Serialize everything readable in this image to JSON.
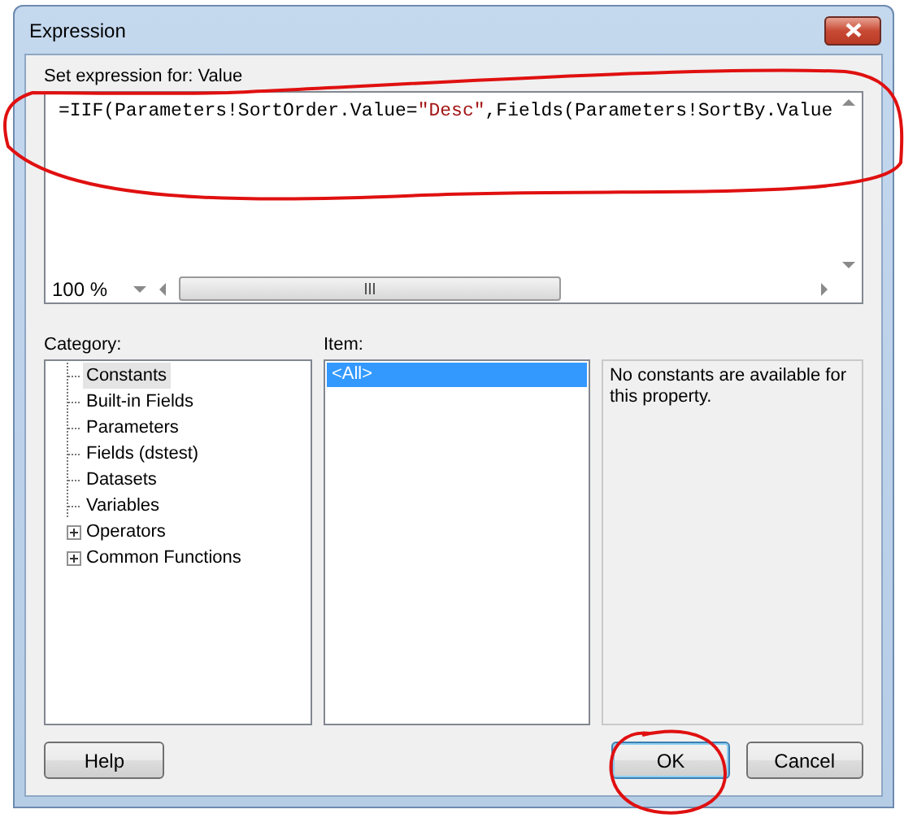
{
  "window": {
    "title": "Expression"
  },
  "expression": {
    "label": "Set expression for: Value",
    "tokens": [
      {
        "text": "=IIF(Parameters!SortOrder.Value=",
        "kind": "code"
      },
      {
        "text": "\"Desc\"",
        "kind": "string"
      },
      {
        "text": ",Fields(Parameters!SortBy.Value",
        "kind": "code"
      }
    ],
    "zoom": "100 %"
  },
  "category": {
    "label": "Category:",
    "items": [
      {
        "label": "Constants",
        "selected": true,
        "expandable": false
      },
      {
        "label": "Built-in Fields",
        "selected": false,
        "expandable": false
      },
      {
        "label": "Parameters",
        "selected": false,
        "expandable": false
      },
      {
        "label": "Fields (dstest)",
        "selected": false,
        "expandable": false
      },
      {
        "label": "Datasets",
        "selected": false,
        "expandable": false
      },
      {
        "label": "Variables",
        "selected": false,
        "expandable": false
      },
      {
        "label": "Operators",
        "selected": false,
        "expandable": true
      },
      {
        "label": "Common Functions",
        "selected": false,
        "expandable": true
      }
    ]
  },
  "item": {
    "label": "Item:",
    "items": [
      {
        "label": "<All>",
        "selected": true
      }
    ]
  },
  "description": "No constants are available for this property.",
  "buttons": [
    {
      "label": "Help",
      "kind": "left"
    },
    {
      "label": "OK",
      "kind": "default"
    },
    {
      "label": "Cancel",
      "kind": "right"
    }
  ]
}
